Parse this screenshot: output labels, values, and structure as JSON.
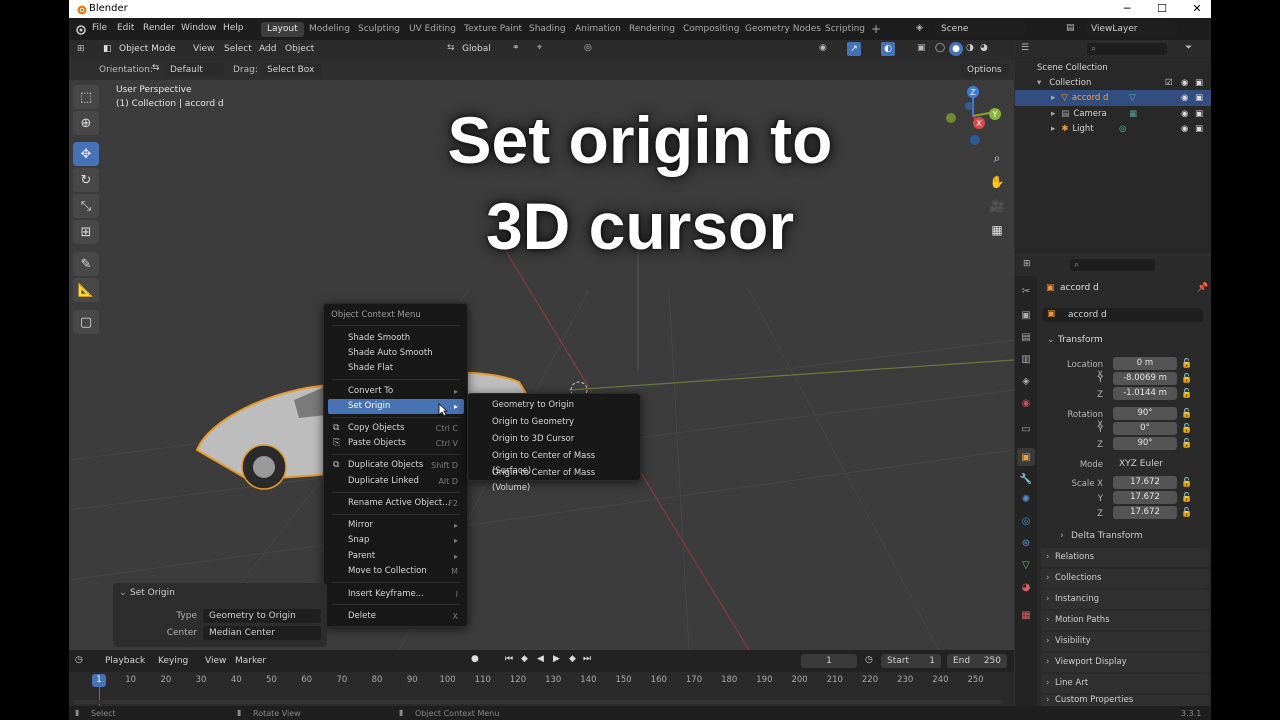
{
  "window": {
    "title": "Blender",
    "minimize": "─",
    "maximize": "☐",
    "close": "✕"
  },
  "menubar": {
    "items": [
      "File",
      "Edit",
      "Render",
      "Window",
      "Help"
    ],
    "workspaces": [
      "Layout",
      "Modeling",
      "Sculpting",
      "UV Editing",
      "Texture Paint",
      "Shading",
      "Animation",
      "Rendering",
      "Compositing",
      "Geometry Nodes",
      "Scripting"
    ],
    "add_tab": "+",
    "scene": "Scene",
    "view_layer": "ViewLayer"
  },
  "viewport_header": {
    "mode": "Object Mode",
    "menus": [
      "View",
      "Select",
      "Add",
      "Object"
    ],
    "transform_orientation": "Global",
    "options": "Options",
    "orientation_label": "Orientation:",
    "orientation_value": "Default",
    "drag_label": "Drag:",
    "drag_value": "Select Box"
  },
  "viewport": {
    "perspective": "User Perspective",
    "collection_info": "(1) Collection | accord d",
    "overlay_title_line1": "Set origin to",
    "overlay_title_line2": "3D cursor",
    "gizmo": {
      "z": "Z",
      "y": "Y",
      "x": "X"
    }
  },
  "context_menu": {
    "title": "Object Context Menu",
    "items": [
      {
        "label": "Shade Smooth",
        "shortcut": ""
      },
      {
        "label": "Shade Auto Smooth",
        "shortcut": ""
      },
      {
        "label": "Shade Flat",
        "shortcut": ""
      },
      {
        "label": "Convert To",
        "shortcut": "▸"
      },
      {
        "label": "Set Origin",
        "shortcut": "▸"
      },
      {
        "label": "Copy Objects",
        "shortcut": "Ctrl C"
      },
      {
        "label": "Paste Objects",
        "shortcut": "Ctrl V"
      },
      {
        "label": "Duplicate Objects",
        "shortcut": "Shift D"
      },
      {
        "label": "Duplicate Linked",
        "shortcut": "Alt D"
      },
      {
        "label": "Rename Active Object...",
        "shortcut": "F2"
      },
      {
        "label": "Mirror",
        "shortcut": "▸"
      },
      {
        "label": "Snap",
        "shortcut": "▸"
      },
      {
        "label": "Parent",
        "shortcut": "▸"
      },
      {
        "label": "Move to Collection",
        "shortcut": "M"
      },
      {
        "label": "Insert Keyframe...",
        "shortcut": "I"
      },
      {
        "label": "Delete",
        "shortcut": "X"
      }
    ]
  },
  "submenu": {
    "items": [
      "Geometry to Origin",
      "Origin to Geometry",
      "Origin to 3D Cursor",
      "Origin to Center of Mass (Surface)",
      "Origin to Center of Mass (Volume)"
    ]
  },
  "last_op_panel": {
    "title": "Set Origin",
    "type_label": "Type",
    "type_value": "Geometry to Origin",
    "center_label": "Center",
    "center_value": "Median Center"
  },
  "outliner": {
    "scene_collection": "Scene Collection",
    "collection": "Collection",
    "objects": [
      "accord d",
      "Camera",
      "Light"
    ]
  },
  "properties": {
    "object_name": "accord d",
    "datablock": "accord d",
    "transform_label": "Transform",
    "location": {
      "label": "Location X",
      "x": "0 m",
      "y": "-8.0069 m",
      "z": "-1.0144 m"
    },
    "rotation": {
      "label": "Rotation X",
      "x": "90°",
      "y": "0°",
      "z": "90°"
    },
    "mode_label": "Mode",
    "mode_value": "XYZ Euler",
    "scale": {
      "label": "Scale X",
      "x": "17.672",
      "y": "17.672",
      "z": "17.672"
    },
    "axis_y": "Y",
    "axis_z": "Z",
    "delta_transform": "Delta Transform",
    "panels": [
      "Relations",
      "Collections",
      "Instancing",
      "Motion Paths",
      "Visibility",
      "Viewport Display",
      "Line Art",
      "Custom Properties"
    ]
  },
  "timeline": {
    "menus": [
      "Playback",
      "Keying",
      "View",
      "Marker"
    ],
    "current_frame": "1",
    "start_label": "Start",
    "start": "1",
    "end_label": "End",
    "end": "250",
    "ticks": [
      "1",
      "10",
      "20",
      "30",
      "40",
      "50",
      "60",
      "70",
      "80",
      "90",
      "100",
      "110",
      "120",
      "130",
      "140",
      "150",
      "160",
      "170",
      "180",
      "190",
      "200",
      "210",
      "220",
      "230",
      "240",
      "250"
    ]
  },
  "statusbar": {
    "select": "Select",
    "rotate": "Rotate View",
    "context": "Object Context Menu",
    "version": "3.3.1"
  }
}
